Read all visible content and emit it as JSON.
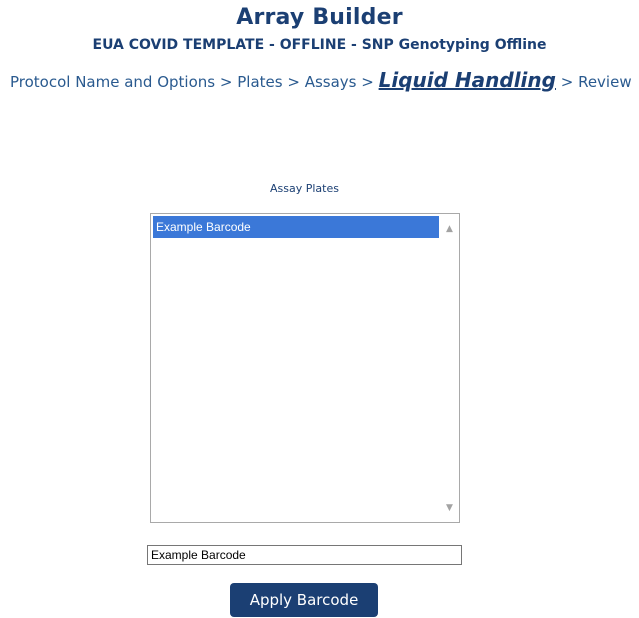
{
  "header": {
    "title": "Array Builder",
    "subtitle": "EUA COVID TEMPLATE - OFFLINE - SNP Genotyping Offline"
  },
  "breadcrumb": {
    "separator": ">",
    "items": [
      {
        "label": "Protocol Name and Options",
        "active": false
      },
      {
        "label": "Plates",
        "active": false
      },
      {
        "label": "Assays",
        "active": false
      },
      {
        "label": "Liquid Handling",
        "active": true
      },
      {
        "label": "Review",
        "active": false
      }
    ]
  },
  "assay_plates": {
    "label": "Assay Plates",
    "options": [
      "Example Barcode"
    ],
    "selected": "Example Barcode",
    "scroll_up_icon": "triangle-up-icon",
    "scroll_down_icon": "triangle-down-icon"
  },
  "barcode_input": {
    "value": "Example Barcode"
  },
  "apply_button": {
    "label": "Apply Barcode"
  }
}
